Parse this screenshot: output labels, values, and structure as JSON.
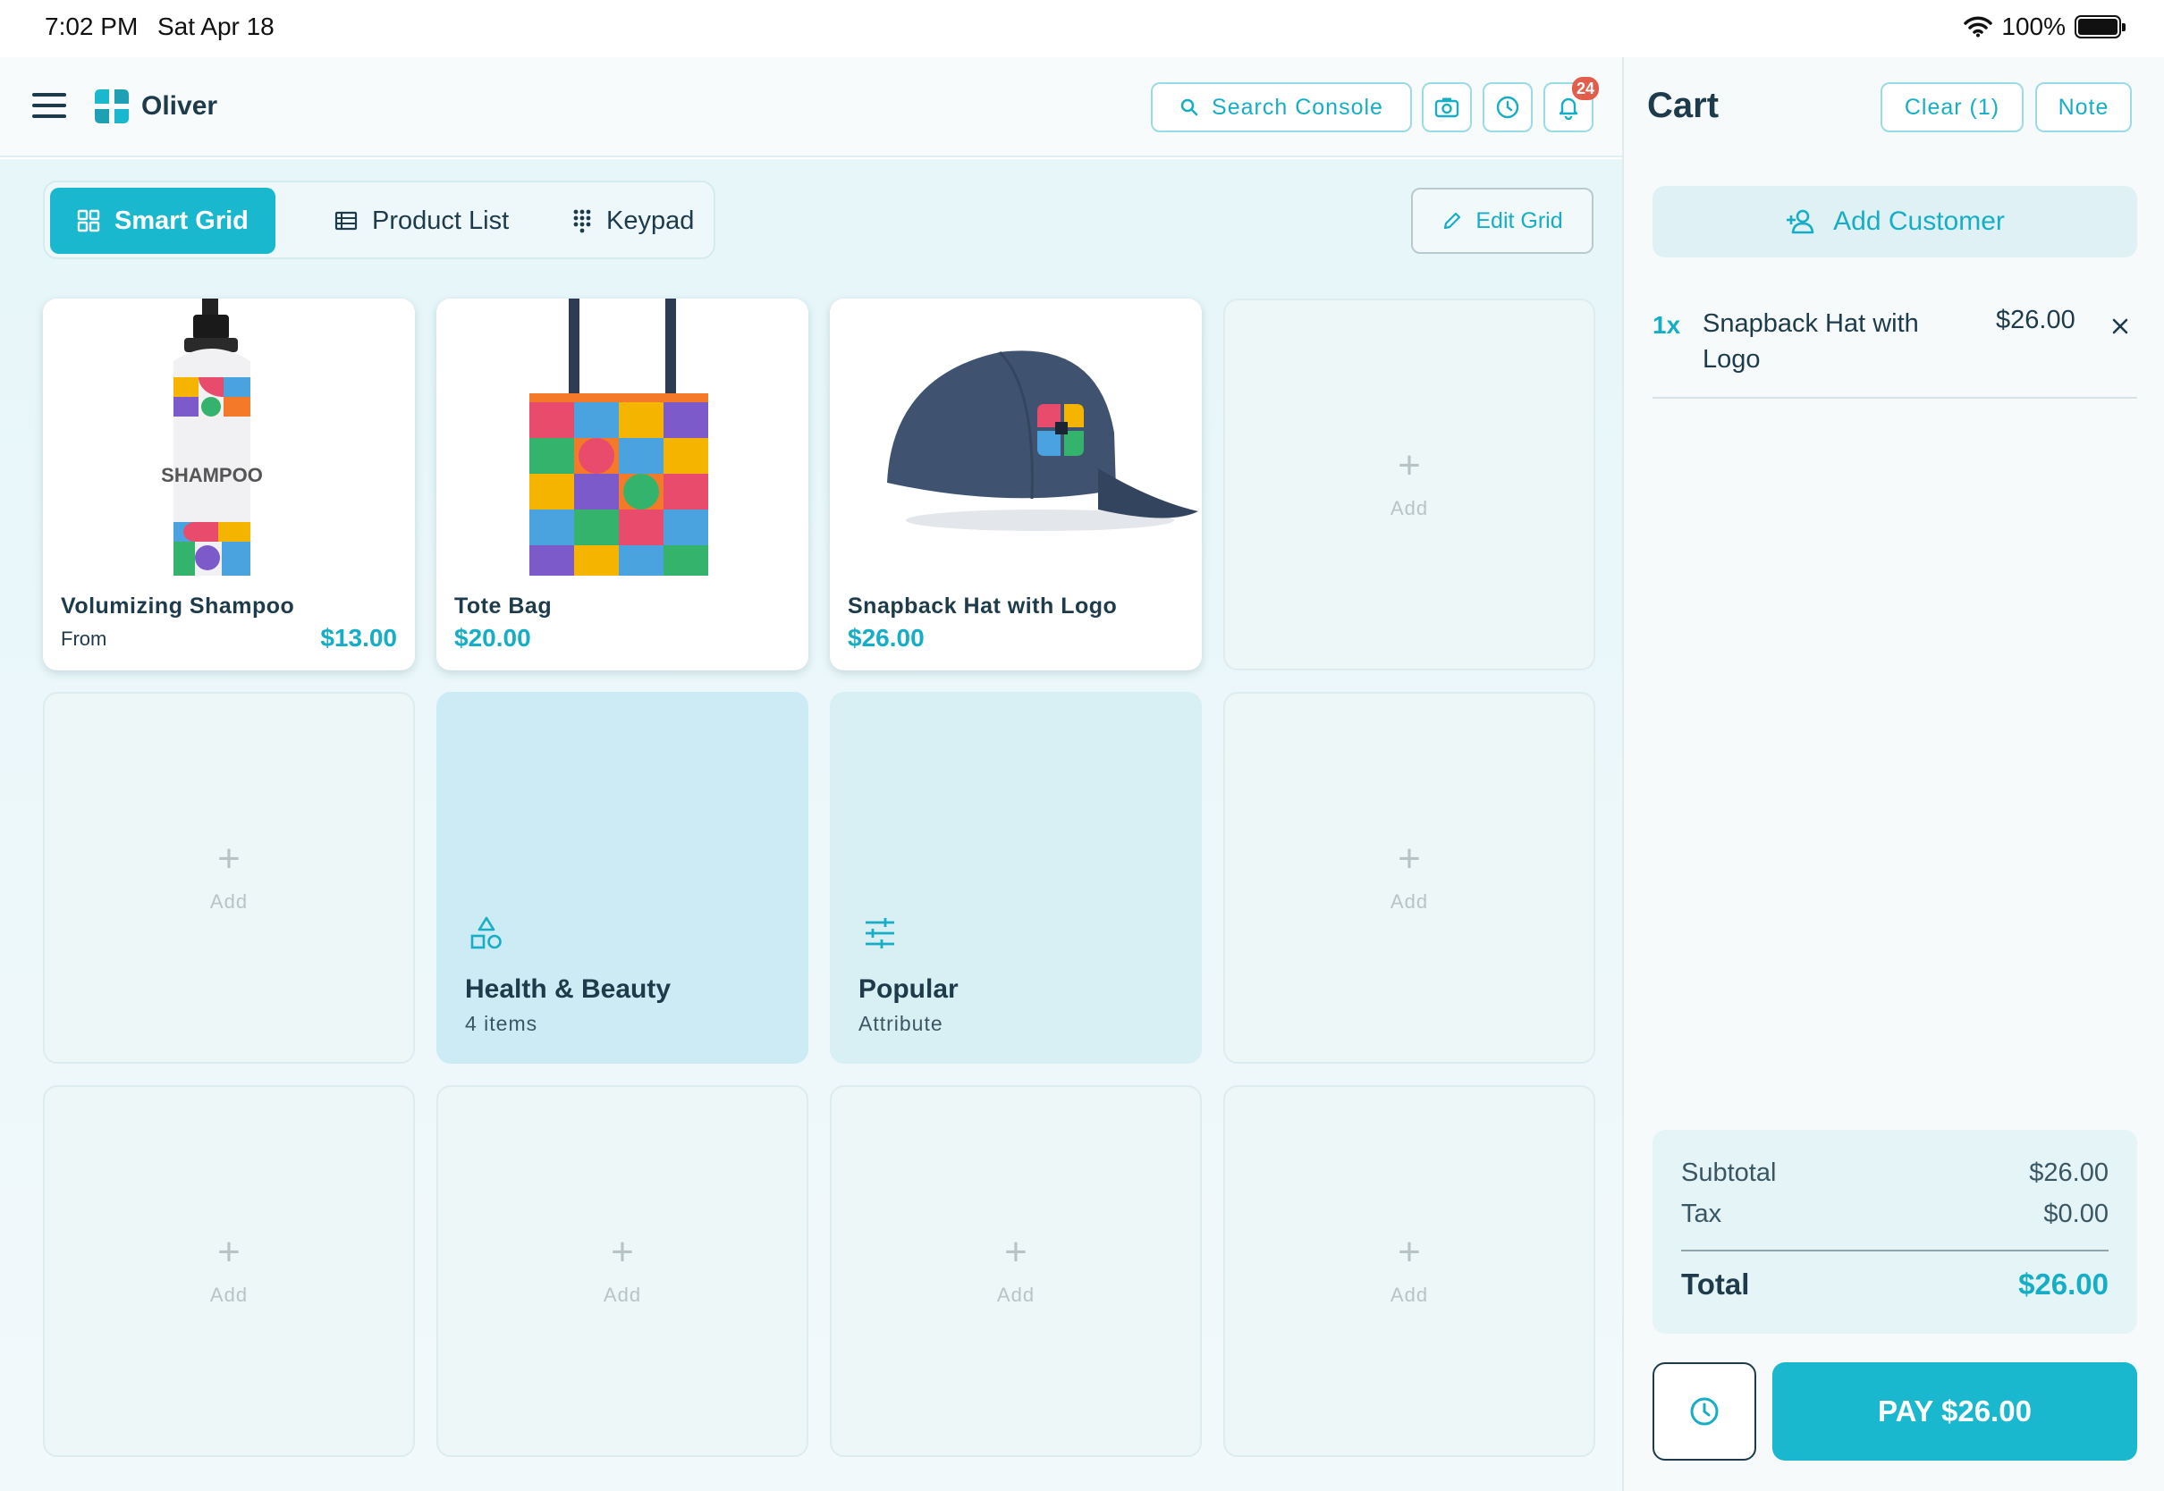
{
  "status": {
    "time": "7:02 PM",
    "date": "Sat Apr 18",
    "battery": "100%"
  },
  "header": {
    "app_name": "Oliver",
    "search_label": "Search Console",
    "notification_count": "24"
  },
  "view_tabs": [
    {
      "label": "Smart Grid",
      "active": true
    },
    {
      "label": "Product List",
      "active": false
    },
    {
      "label": "Keypad",
      "active": false
    }
  ],
  "edit_grid_label": "Edit Grid",
  "grid": {
    "add_label": "Add",
    "products": [
      {
        "name": "Volumizing Shampoo",
        "prefix": "From",
        "price": "$13.00",
        "image_text": "SHAMPOO"
      },
      {
        "name": "Tote Bag",
        "price": "$20.00"
      },
      {
        "name": "Snapback Hat with Logo",
        "price": "$26.00"
      }
    ],
    "category": {
      "title": "Health & Beauty",
      "subtitle": "4 items",
      "icon": "shapes-icon"
    },
    "attribute": {
      "title": "Popular",
      "subtitle": "Attribute",
      "icon": "sliders-icon"
    }
  },
  "cart": {
    "title": "Cart",
    "clear_label": "Clear (1)",
    "note_label": "Note",
    "add_customer_label": "Add Customer",
    "items": [
      {
        "qty": "1x",
        "name": "Snapback Hat with Logo",
        "price": "$26.00"
      }
    ],
    "subtotal_label": "Subtotal",
    "subtotal": "$26.00",
    "tax_label": "Tax",
    "tax": "$0.00",
    "total_label": "Total",
    "total": "$26.00",
    "pay_label": "PAY $26.00"
  },
  "colors": {
    "accent": "#19b8cf",
    "text": "#1d3b4a",
    "badge": "#e35d4c"
  }
}
